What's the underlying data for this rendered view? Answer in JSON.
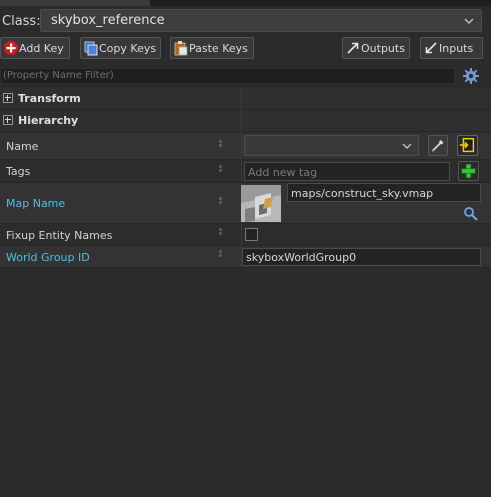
{
  "class_row": {
    "label": "Class:",
    "value": "skybox_reference"
  },
  "toolbar": {
    "add_key": "Add Key",
    "copy_keys": "Copy Keys",
    "paste_keys": "Paste Keys",
    "outputs": "Outputs",
    "inputs": "Inputs"
  },
  "filter": {
    "placeholder": "(Property Name Filter)"
  },
  "sections": [
    {
      "name": "Transform"
    },
    {
      "name": "Hierarchy"
    }
  ],
  "properties": {
    "name": {
      "label": "Name",
      "value": ""
    },
    "tags": {
      "label": "Tags",
      "placeholder": "Add new tag"
    },
    "map_name": {
      "label": "Map Name",
      "value": "maps/construct_sky.vmap"
    },
    "fixup": {
      "label": "Fixup Entity Names",
      "checked": false
    },
    "world_group": {
      "label": "World Group ID",
      "value": "skyboxWorldGroup0"
    }
  },
  "colors": {
    "link_label": "#4fc0e8",
    "add_green": "#3cc23c",
    "panel_bg": "#2b2b2b"
  }
}
